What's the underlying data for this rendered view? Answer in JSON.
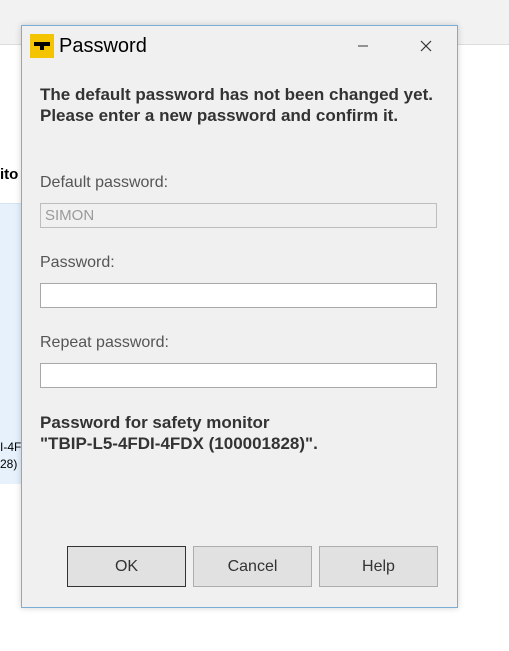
{
  "background": {
    "partial_label": "ito",
    "partial_line1": "I-4F",
    "partial_line2": "28)"
  },
  "dialog": {
    "title": "Password",
    "icon": "turck-logo-icon",
    "minimize_icon": "minimize-icon",
    "close_icon": "close-icon",
    "message": "The default password has not been changed yet. Please enter a new password and confirm it.",
    "default_password_label": "Default password:",
    "default_password_value": "SIMON",
    "password_label": "Password:",
    "password_value": "",
    "repeat_password_label": "Repeat password:",
    "repeat_password_value": "",
    "info_line1": "Password for safety monitor",
    "info_line2": "\"TBIP-L5-4FDI-4FDX (100001828)\".",
    "buttons": {
      "ok": "OK",
      "cancel": "Cancel",
      "help": "Help"
    }
  },
  "colors": {
    "dialog_bg": "#f0f0f0",
    "dialog_border": "#7aaed6",
    "icon_yellow": "#f5c400"
  }
}
